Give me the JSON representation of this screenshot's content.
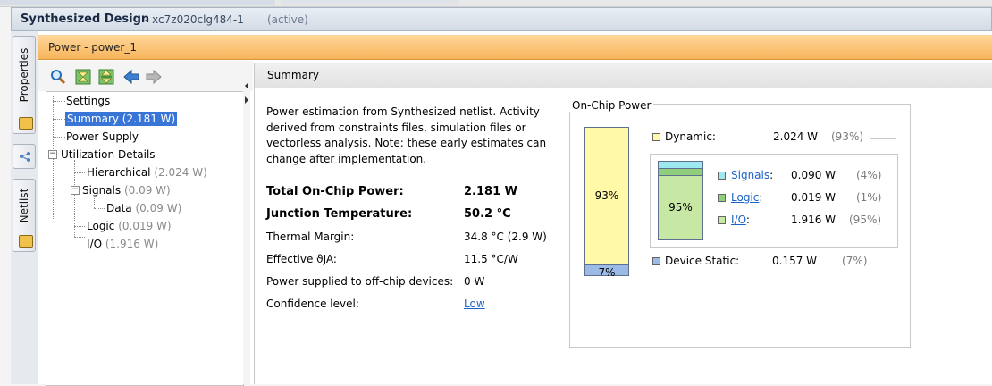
{
  "window": {
    "title": "Synthesized Design",
    "part": "- xc7z020clg484-1",
    "state": "(active)"
  },
  "side_tabs": [
    {
      "label": "Properties"
    },
    {
      "label": "Netlist"
    }
  ],
  "panel": {
    "title": "Power - power_1"
  },
  "toolbar": {
    "icons": [
      "search-icon",
      "collapse-all-icon",
      "expand-all-icon",
      "back-arrow-icon",
      "forward-arrow-icon"
    ]
  },
  "tree": {
    "settings": "Settings",
    "summary": "Summary (2.181 W)",
    "power_supply": "Power Supply",
    "utilization": "Utilization Details",
    "hierarchical": {
      "label": "Hierarchical",
      "value": "(2.024 W)"
    },
    "signals": {
      "label": "Signals",
      "value": "(0.09 W)"
    },
    "data": {
      "label": "Data",
      "value": "(0.09 W)"
    },
    "logic": {
      "label": "Logic",
      "value": "(0.019 W)"
    },
    "io": {
      "label": "I/O",
      "value": "(1.916 W)"
    }
  },
  "summary": {
    "header": "Summary",
    "description": "Power estimation from Synthesized netlist. Activity derived from constraints files, simulation files or vectorless analysis. Note: these early estimates can change after implementation.",
    "rows": [
      {
        "label": "Total On-Chip Power:",
        "value": "2.181 W",
        "bold": true
      },
      {
        "label": "Junction Temperature:",
        "value": "50.2 °C",
        "bold": true
      },
      {
        "label": "Thermal Margin:",
        "value": "34.8 °C (2.9 W)"
      },
      {
        "label": "Effective ϑJA:",
        "value": "11.5 °C/W"
      },
      {
        "label": "Power supplied to off-chip devices:",
        "value": "0 W"
      },
      {
        "label": "Confidence level:",
        "value": "Low",
        "link": true
      }
    ]
  },
  "onchip": {
    "title": "On-Chip Power",
    "dynamic": {
      "label": "Dynamic:",
      "value": "2.024 W",
      "pct": "(93%)",
      "bar_label": "93%",
      "fraction": 0.93,
      "color": "#fff9a8"
    },
    "static": {
      "label": "Device Static:",
      "value": "0.157 W",
      "pct": "(7%)",
      "bar_label": "7%",
      "fraction": 0.07,
      "color": "#9bbbe6"
    },
    "breakdown_bar_label": "95%",
    "breakdown": [
      {
        "label": "Signals",
        "suffix": ":",
        "value": "0.090 W",
        "pct": "(4%)",
        "fraction": 0.04,
        "color": "#9ee8ef"
      },
      {
        "label": "Logic",
        "suffix": ":",
        "value": "0.019 W",
        "pct": "(1%)",
        "fraction": 0.01,
        "color": "#8fce7d"
      },
      {
        "label": "I/O",
        "suffix": ":",
        "value": "1.916 W",
        "pct": "(95%)",
        "fraction": 0.95,
        "color": "#c7e7a4"
      }
    ]
  }
}
